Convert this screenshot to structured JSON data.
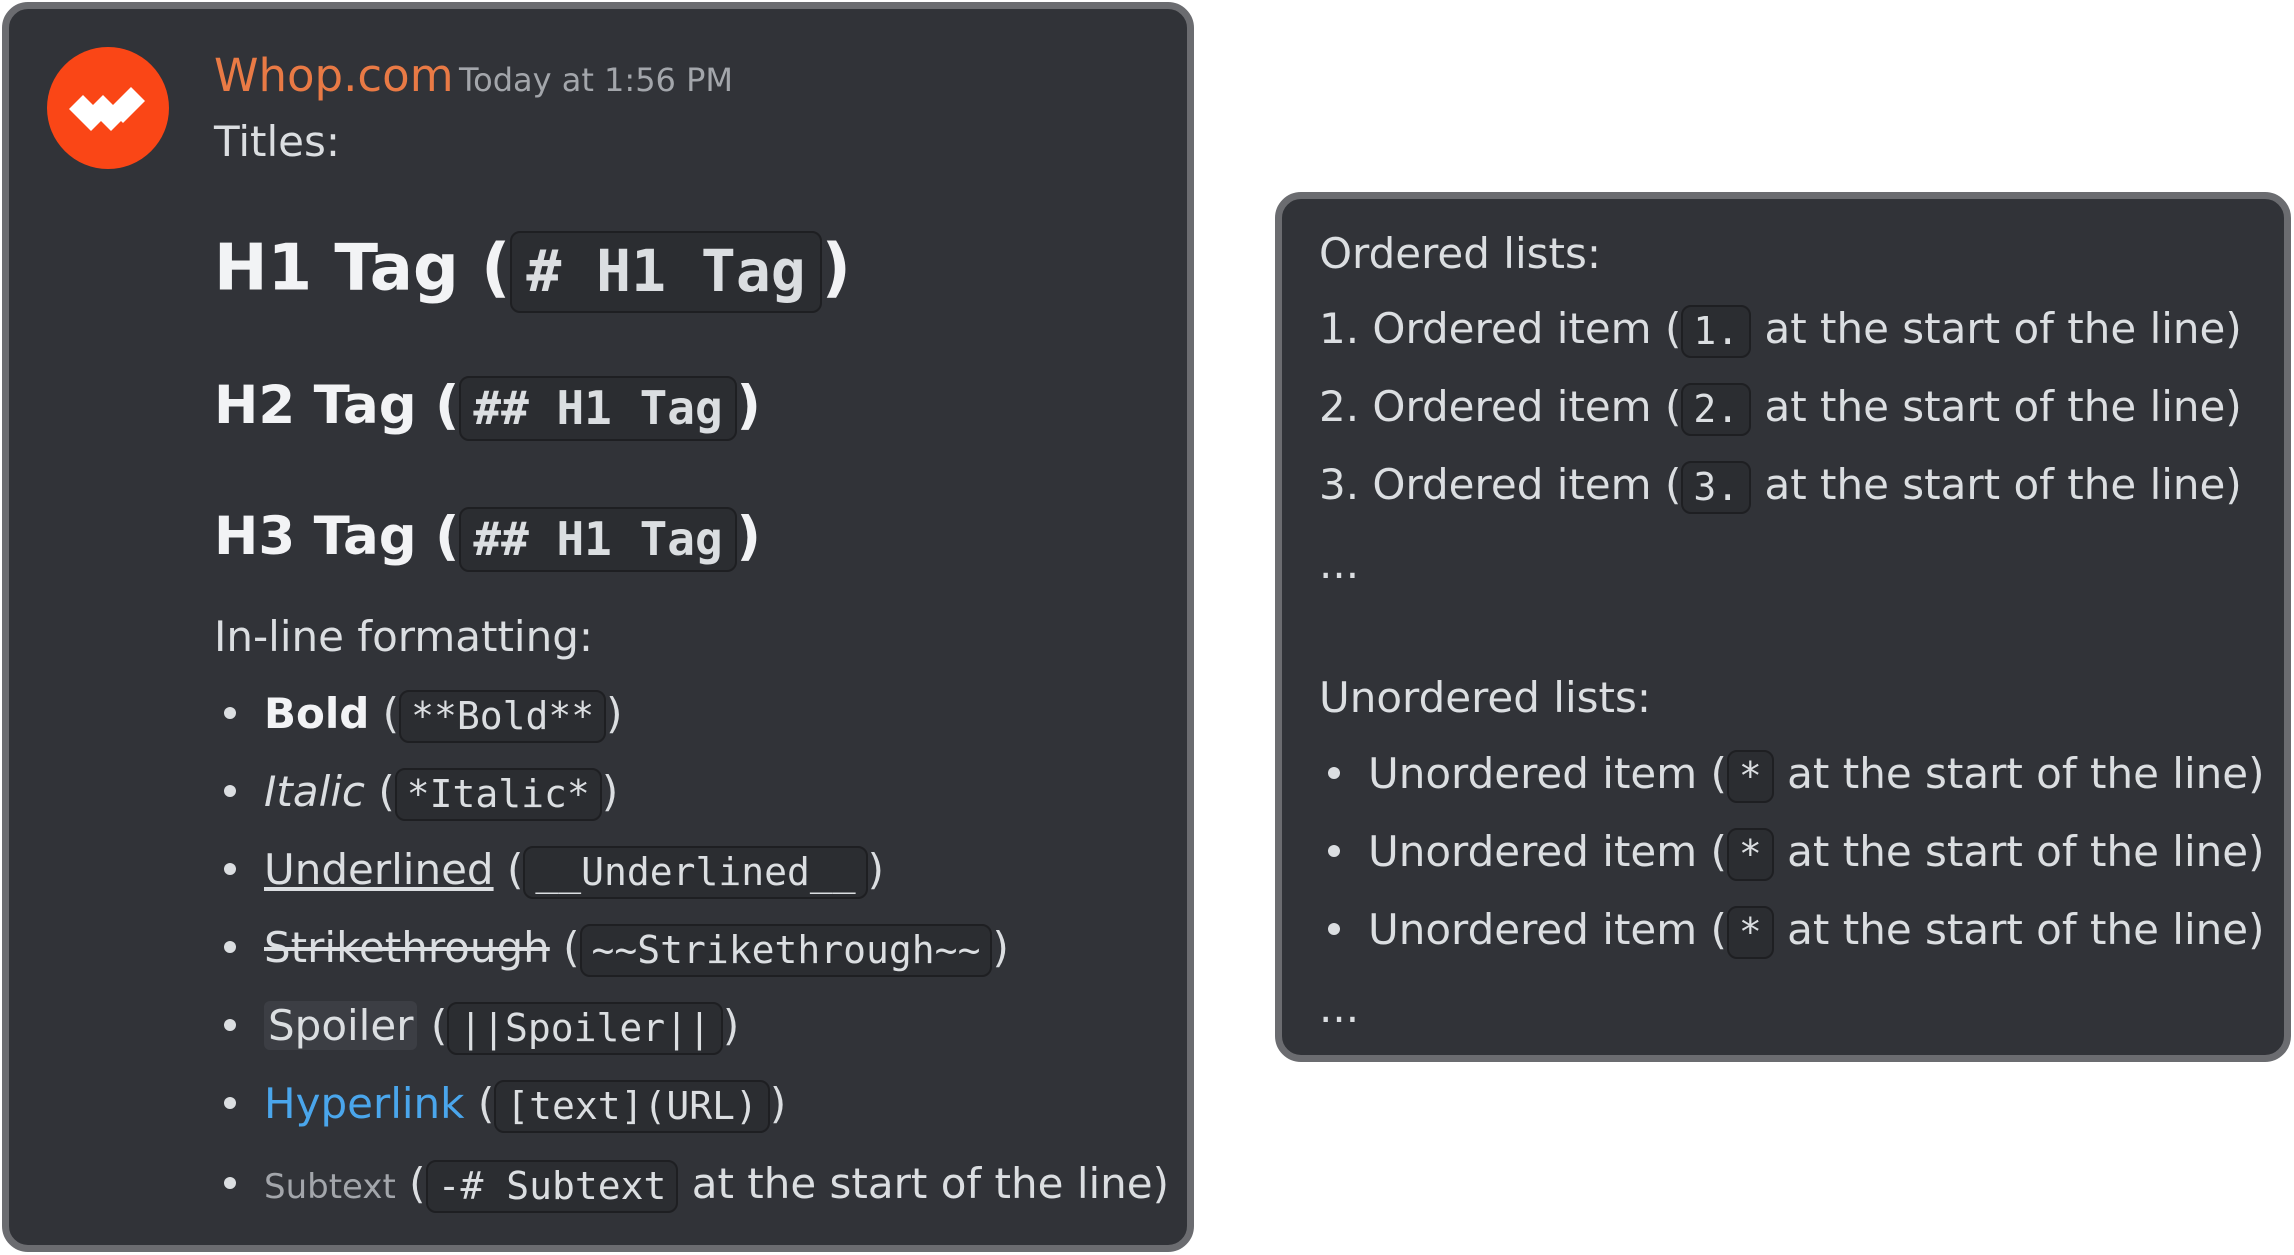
{
  "message": {
    "username": "Whop.com",
    "timestamp": "Today at 1:56 PM",
    "titles_label": "Titles:",
    "h1": {
      "label": "H1 Tag",
      "code": "# H1 Tag"
    },
    "h2": {
      "label": "H2 Tag",
      "code": "## H1 Tag"
    },
    "h3": {
      "label": "H3 Tag",
      "code": "## H1 Tag"
    },
    "inline_label": "In-line formatting:",
    "inline_items": [
      {
        "label": "Bold",
        "code": "**Bold**"
      },
      {
        "label": "Italic",
        "code": "*Italic*"
      },
      {
        "label": "Underlined",
        "code": "__Underlined__"
      },
      {
        "label": "Strikethrough",
        "code": "~~Strikethrough~~"
      },
      {
        "label": "Spoiler",
        "code": "||Spoiler||"
      },
      {
        "label": "Hyperlink",
        "code": "[text](URL)"
      },
      {
        "label": "Subtext",
        "code": "-# Subtext",
        "suffix": "at the start of the line)"
      }
    ]
  },
  "lists_card": {
    "ordered_label": "Ordered lists:",
    "ordered_items": [
      {
        "prefix": "1. Ordered item (",
        "code": "1.",
        "suffix": "at the start of the line)"
      },
      {
        "prefix": "2. Ordered item (",
        "code": "2.",
        "suffix": "at the start of the line)"
      },
      {
        "prefix": "3. Ordered item (",
        "code": "3.",
        "suffix": "at the start of the line)"
      }
    ],
    "ordered_ellipsis": "...",
    "unordered_label": "Unordered lists:",
    "unordered_items": [
      {
        "prefix": "Unordered item (",
        "code": "*",
        "suffix": "at the start of the line)"
      },
      {
        "prefix": "Unordered item (",
        "code": "*",
        "suffix": "at the start of the line)"
      },
      {
        "prefix": "Unordered item (",
        "code": "*",
        "suffix": "at the start of the line)"
      }
    ],
    "unordered_ellipsis": "..."
  },
  "colors": {
    "background": "#313338",
    "username": "#e97a45",
    "link": "#4aa6ec",
    "avatar": "#fa4616"
  },
  "icons": {
    "avatar": "whop-logo-icon"
  }
}
